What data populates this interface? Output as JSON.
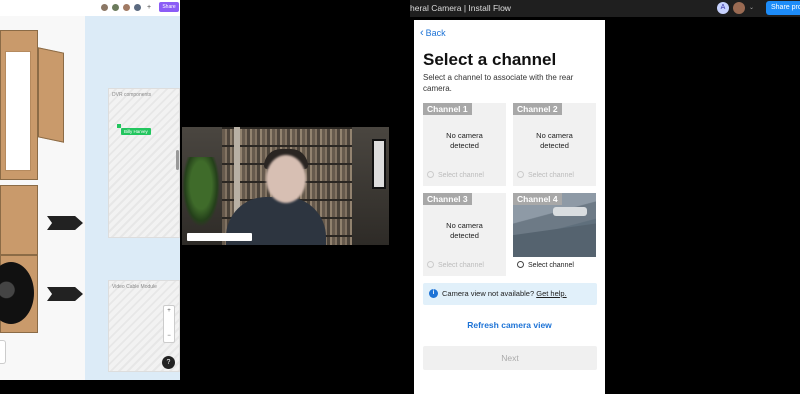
{
  "left_panel": {
    "share_label": "Share",
    "avatar_more": "+",
    "frames": [
      {
        "label": "DVR components"
      },
      {
        "label": "Video Cable Module"
      }
    ],
    "cursor_tag": "Billy Harvey",
    "zoom": {
      "plus": "+",
      "minus": "−"
    },
    "help": "?"
  },
  "app": {
    "title": "heral Camera | Install Flow",
    "title_caret": "⌄",
    "avatar_initial": "A",
    "share_button": "Share pro"
  },
  "screen": {
    "back_label": "Back",
    "heading": "Select a channel",
    "subtitle": "Select a channel to associate with the rear camera.",
    "channels": [
      {
        "name": "Channel 1",
        "status": "No camera detected",
        "select_label": "Select channel",
        "selectable": false
      },
      {
        "name": "Channel 2",
        "status": "No camera detected",
        "select_label": "Select channel",
        "selectable": false
      },
      {
        "name": "Channel 3",
        "status": "No camera detected",
        "select_label": "Select channel",
        "selectable": false
      },
      {
        "name": "Channel 4",
        "status": "",
        "select_label": "Select channel",
        "selectable": true
      }
    ],
    "info": {
      "text": "Camera view not available?",
      "link": "Get help."
    },
    "refresh_label": "Refresh camera view",
    "next_label": "Next"
  },
  "colors": {
    "accent": "#1d73d6",
    "share_blue": "#1d8cf8",
    "share_purple": "#8b5cf6",
    "tag_green": "#22c55e"
  }
}
